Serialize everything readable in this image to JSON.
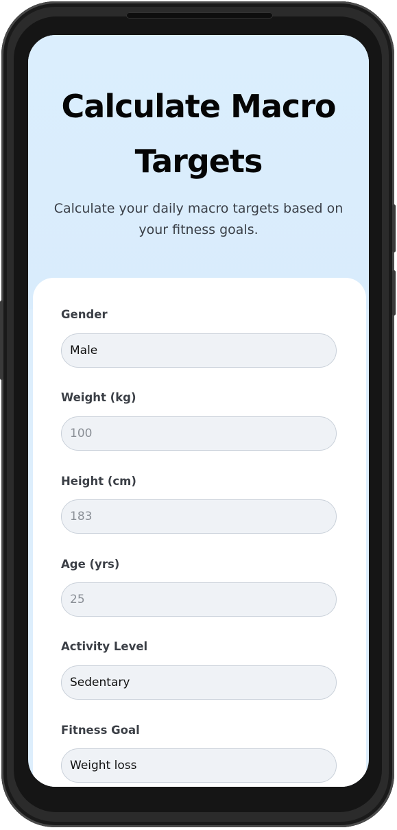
{
  "header": {
    "title": "Calculate Macro Targets",
    "subtitle": "Calculate your daily macro targets based on your fitness goals."
  },
  "form": {
    "gender": {
      "label": "Gender",
      "value": "Male"
    },
    "weight": {
      "label": "Weight (kg)",
      "placeholder": "100"
    },
    "height": {
      "label": "Height (cm)",
      "placeholder": "183"
    },
    "age": {
      "label": "Age (yrs)",
      "placeholder": "25"
    },
    "activity": {
      "label": "Activity Level",
      "value": "Sedentary"
    },
    "goal": {
      "label": "Fitness Goal",
      "value": "Weight loss"
    }
  },
  "colors": {
    "background": "#ddeefc",
    "card": "#ffffff",
    "field": "#eff2f6",
    "field_border": "#c9d0d9",
    "title": "#050505"
  }
}
